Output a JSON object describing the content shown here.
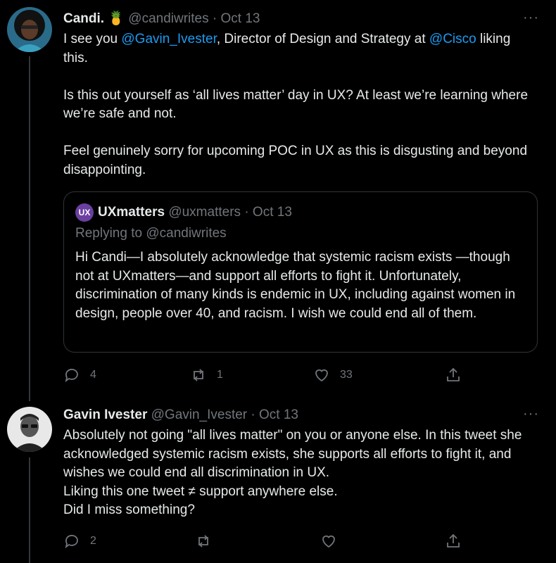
{
  "tweet1": {
    "display_name": "Candi.",
    "emoji": "🍍",
    "handle": "@candiwrites",
    "sep": "·",
    "date": "Oct 13",
    "more": "···",
    "text": {
      "pre": "I see you ",
      "mention1": "@Gavin_Ivester",
      "mid": ", Director of Design and Strategy at ",
      "mention2": "@Cisco",
      "post": " liking this.",
      "para2": "Is this out yourself as ‘all lives matter’ day in UX? At least we’re learning where we’re safe and not.",
      "para3": "Feel genuinely sorry for upcoming POC in UX as this is disgusting and beyond disappointing."
    },
    "quote": {
      "logo_text": "UX",
      "display_name": "UXmatters",
      "handle": "@uxmatters",
      "sep": "·",
      "date": "Oct 13",
      "replying_to": "Replying to @candiwrites",
      "text": "Hi Candi—I absolutely acknowledge that systemic racism exists —though not at UXmatters—and support all efforts to fight it. Unfortunately, discrimination of many kinds is endemic in UX, including against women in design, people over 40, and racism. I wish we could end all of them."
    },
    "actions": {
      "replies": "4",
      "retweets": "1",
      "likes": "33"
    }
  },
  "tweet2": {
    "display_name": "Gavin Ivester",
    "handle": "@Gavin_Ivester",
    "sep": "·",
    "date": "Oct 13",
    "more": "···",
    "lines": [
      "Absolutely not going \"all lives matter\" on you or anyone else. In this tweet she acknowledged systemic racism exists, she supports all efforts to fight it, and wishes we could end all discrimination in UX.",
      "Liking this one tweet ≠ support anywhere else.",
      "Did I miss something?"
    ],
    "actions": {
      "replies": "2"
    }
  },
  "colors": {
    "background": "#000000",
    "text": "#e7e9ea",
    "muted": "#71767b",
    "link": "#1d9bf0",
    "border": "#2f3336"
  },
  "icons": [
    "reply-icon",
    "retweet-icon",
    "like-icon",
    "share-icon",
    "more-icon"
  ]
}
